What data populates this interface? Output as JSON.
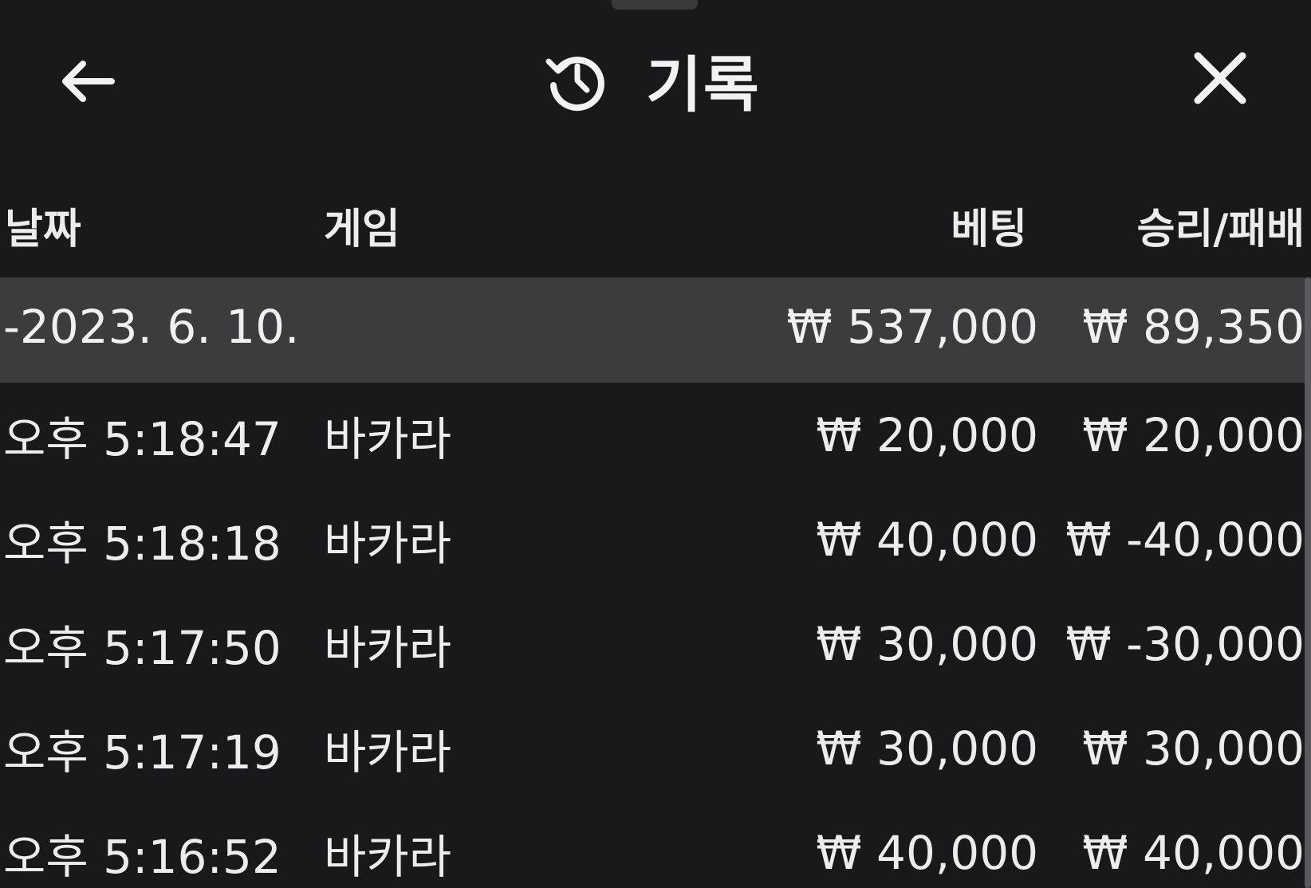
{
  "header": {
    "title": "기록",
    "back_icon": "arrow-left-icon",
    "history_icon": "history-clock-icon",
    "close_icon": "close-icon"
  },
  "columns": {
    "date": "날짜",
    "game": "게임",
    "bet": "베팅",
    "result": "승리/패배"
  },
  "summary": {
    "date": "-2023. 6. 10.",
    "bet": "₩ 537,000",
    "result": "₩ 89,350"
  },
  "rows": [
    {
      "time": "오후 5:18:47",
      "game": "바카라",
      "bet": "₩ 20,000",
      "result": "₩ 20,000"
    },
    {
      "time": "오후 5:18:18",
      "game": "바카라",
      "bet": "₩ 40,000",
      "result": "₩ -40,000"
    },
    {
      "time": "오후 5:17:50",
      "game": "바카라",
      "bet": "₩ 30,000",
      "result": "₩ -30,000"
    },
    {
      "time": "오후 5:17:19",
      "game": "바카라",
      "bet": "₩ 30,000",
      "result": "₩ 30,000"
    },
    {
      "time": "오후 5:16:52",
      "game": "바카라",
      "bet": "₩ 40,000",
      "result": "₩ 40,000"
    }
  ],
  "colors": {
    "background": "#19191b",
    "summary_row": "#3c3c3f",
    "text": "#ececec"
  }
}
